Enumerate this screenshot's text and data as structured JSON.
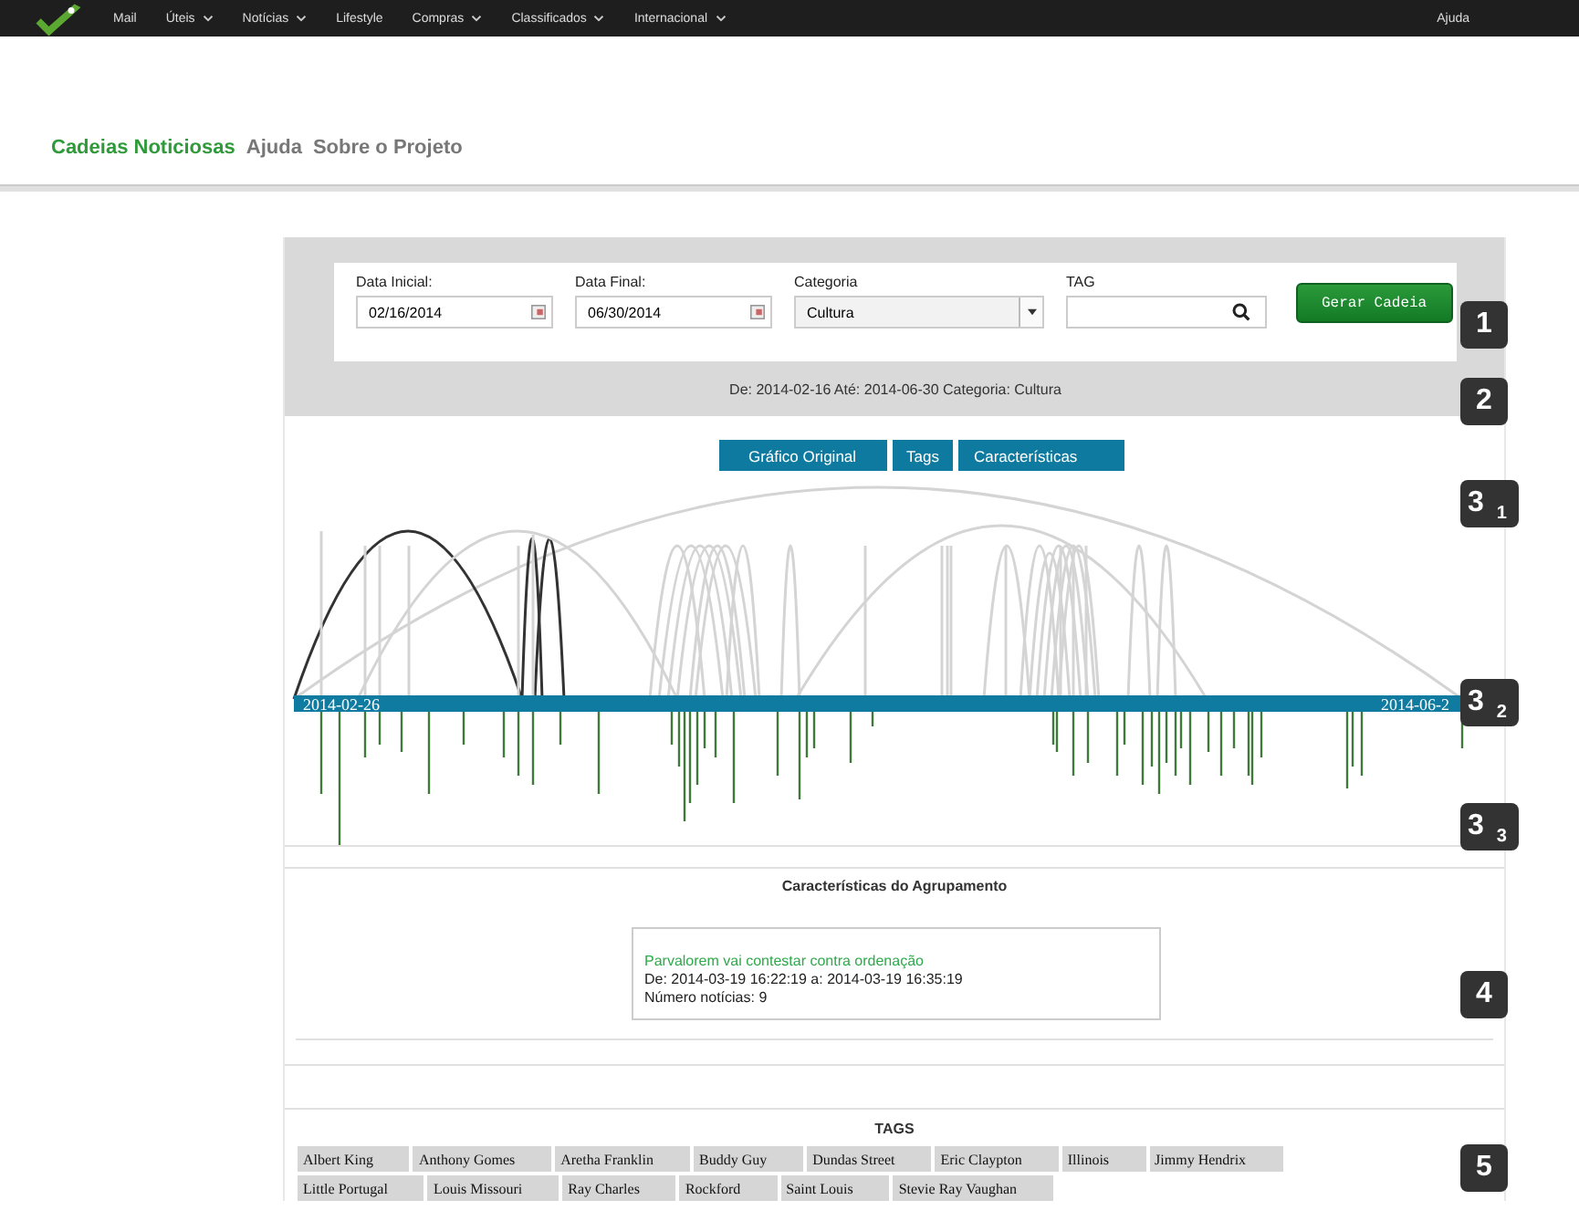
{
  "top_bar": {
    "menu": [
      {
        "label": "Mail",
        "dropdown": false
      },
      {
        "label": "Úteis",
        "dropdown": true
      },
      {
        "label": "Notícias",
        "dropdown": true
      },
      {
        "label": "Lifestyle",
        "dropdown": false
      },
      {
        "label": "Compras",
        "dropdown": true
      },
      {
        "label": "Classificados",
        "dropdown": true
      },
      {
        "label": "Internacional",
        "dropdown": true
      }
    ],
    "help": "Ajuda"
  },
  "nav": [
    {
      "label": "Cadeias Noticiosas",
      "selected": true
    },
    {
      "label": "Ajuda",
      "selected": false
    },
    {
      "label": "Sobre o Projeto",
      "selected": false
    }
  ],
  "filter": {
    "start_label": "Data Inicial:",
    "start_value": "02/16/2014",
    "end_label": "Data Final:",
    "end_value": "06/30/2014",
    "category_label": "Categoria",
    "category_value": "Cultura",
    "tag_label": "TAG",
    "button": "Gerar Cadeia",
    "summary": "De: 2014-02-16 Até: 2014-06-30 Categoria: Cultura"
  },
  "chart_tabs": [
    "Gráfico Original",
    "Tags",
    "Características"
  ],
  "timeline": {
    "start": "2014-02-26",
    "end": "2014-06-2"
  },
  "cluster": {
    "heading": "Características do Agrupamento",
    "title": "Parvalorem vai contestar contra ordenação",
    "range": "De: 2014-03-19 16:22:19 a: 2014-03-19 16:35:19",
    "count": "Número notícias: 9"
  },
  "tags": {
    "heading": "TAGS",
    "items": [
      "Albert King",
      "Anthony Gomes",
      "Aretha Franklin",
      "Buddy Guy",
      "Dundas Street",
      "Eric Claypton",
      "Illinois",
      "Jimmy Hendrix",
      "Little Portugal",
      "Louis Missouri",
      "Ray Charles",
      "Rockford",
      "Saint Louis",
      "Stevie Ray Vaughan"
    ]
  },
  "callouts": [
    {
      "number": "1"
    },
    {
      "number": "2"
    },
    {
      "number": "3",
      "sub": "1"
    },
    {
      "number": "3",
      "sub": "2"
    },
    {
      "number": "3",
      "sub": "3"
    },
    {
      "number": "4"
    },
    {
      "number": "5"
    }
  ]
}
